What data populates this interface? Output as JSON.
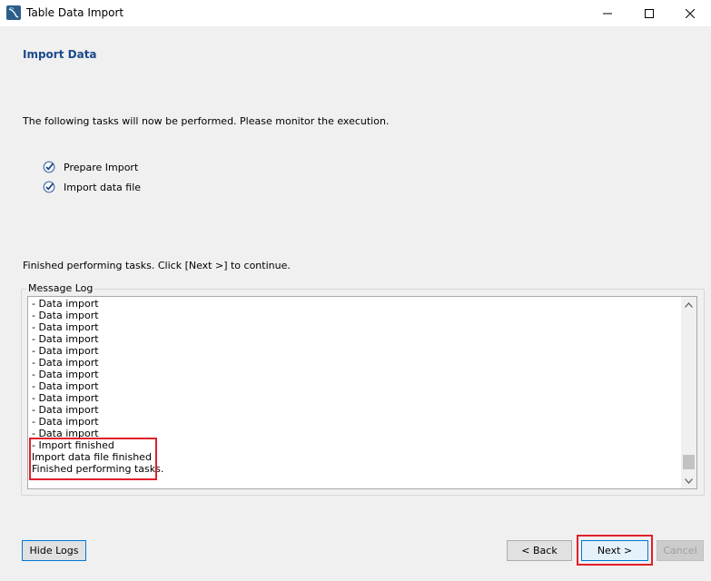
{
  "window": {
    "title": "Table Data Import"
  },
  "page": {
    "title": "Import Data",
    "intro": "The following tasks will now be performed. Please monitor the execution.",
    "tasks": [
      {
        "label": "Prepare Import",
        "status": "done"
      },
      {
        "label": "Import data file",
        "status": "done"
      }
    ],
    "finished_message": "Finished performing tasks. Click [Next >] to continue."
  },
  "message_log": {
    "label": "Message Log",
    "lines": [
      "- Data import",
      "- Data import",
      "- Data import",
      "- Data import",
      "- Data import",
      "- Data import",
      "- Data import",
      "- Data import",
      "- Data import",
      "- Data import",
      "- Data import",
      "- Data import",
      "- Import finished",
      "Import data file finished",
      "Finished performing tasks."
    ]
  },
  "buttons": {
    "hide_logs": "Hide Logs",
    "back": "< Back",
    "next": "Next >",
    "cancel": "Cancel"
  },
  "colors": {
    "title_accent": "#1b4a8c",
    "highlight": "#e0202a",
    "focus": "#0078d7"
  }
}
